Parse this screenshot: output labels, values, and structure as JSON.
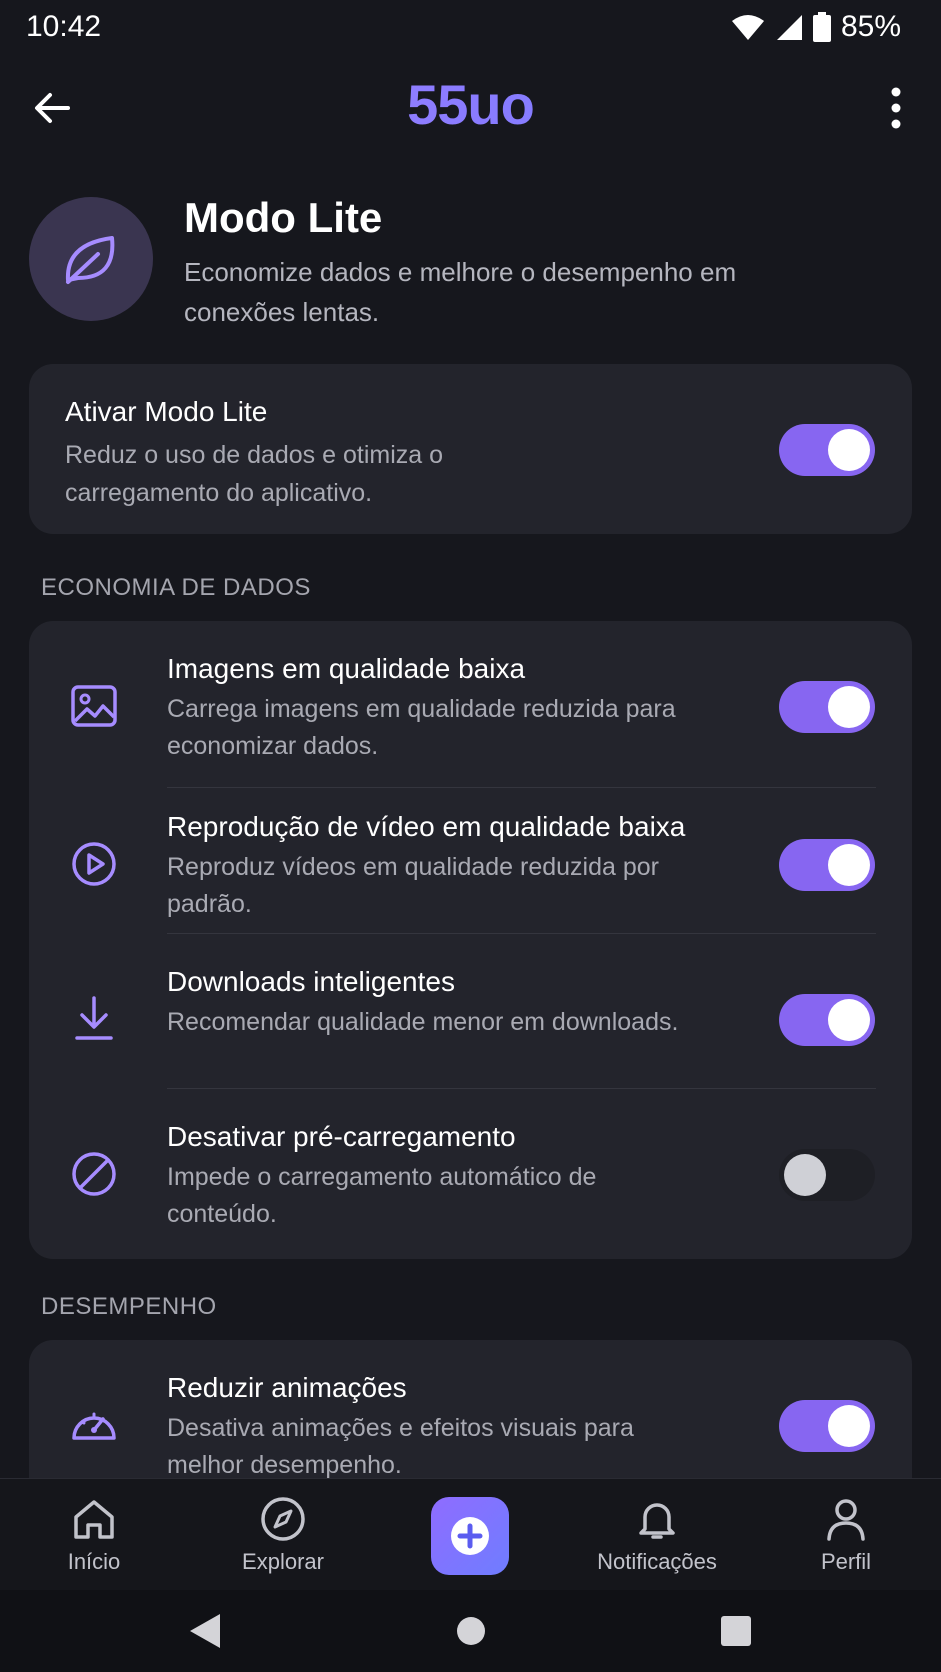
{
  "status": {
    "time": "10:42",
    "battery": "85%"
  },
  "app": {
    "title": "55uo"
  },
  "header": {
    "title": "Modo Lite",
    "description": "Economize dados e melhore o desempenho em conexões lentas."
  },
  "main_toggle": {
    "title": "Ativar Modo Lite",
    "description": "Reduz o uso de dados e otimiza o carregamento do aplicativo.",
    "enabled": true
  },
  "sections": {
    "data_saving": {
      "label": "ECONOMIA DE DADOS",
      "items": [
        {
          "icon": "image-icon",
          "title": "Imagens em qualidade baixa",
          "description": "Carrega imagens em qualidade reduzida para economizar dados.",
          "enabled": true
        },
        {
          "icon": "play-circle-icon",
          "title": "Reprodução de vídeo em qualidade baixa",
          "description": "Reproduz vídeos em qualidade reduzida por padrão.",
          "enabled": true
        },
        {
          "icon": "download-icon",
          "title": "Downloads inteligentes",
          "description": "Recomendar qualidade menor em downloads.",
          "enabled": true
        },
        {
          "icon": "block-icon",
          "title": "Desativar pré-carregamento",
          "description": "Impede o carregamento automático de conteúdo.",
          "enabled": false
        }
      ]
    },
    "performance": {
      "label": "DESEMPENHO",
      "items": [
        {
          "icon": "speedometer-icon",
          "title": "Reduzir animações",
          "description": "Desativa animações e efeitos visuais para melhor desempenho.",
          "enabled": true
        }
      ]
    }
  },
  "nav": {
    "home": "Início",
    "explore": "Explorar",
    "notifications": "Notificações",
    "profile": "Perfil"
  },
  "colors": {
    "accent": "#8766f1",
    "background": "#16171d",
    "card": "#23242c"
  }
}
